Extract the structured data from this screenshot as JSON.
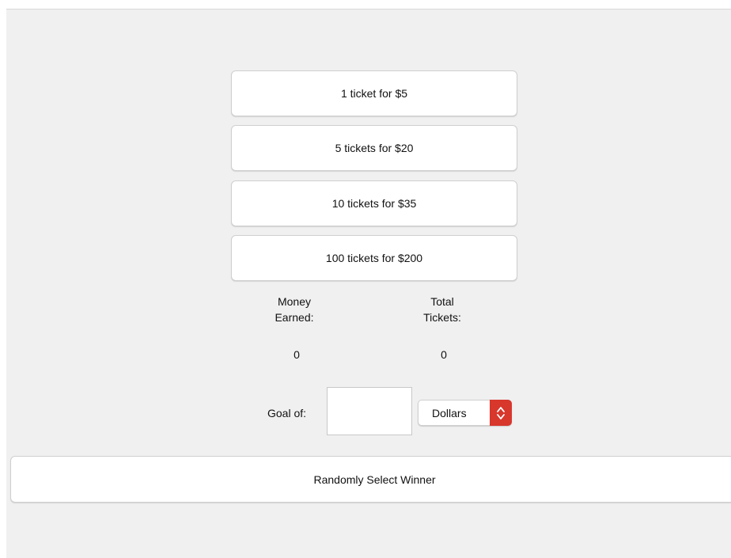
{
  "tickets": [
    {
      "label": "1 ticket for $5"
    },
    {
      "label": "5 tickets for $20"
    },
    {
      "label": "10 tickets for $35"
    },
    {
      "label": "100 tickets for $200"
    }
  ],
  "stats": {
    "money_label": "Money\nEarned:",
    "money_value": "0",
    "tickets_label": "Total\nTickets:",
    "tickets_value": "0"
  },
  "goal": {
    "label": "Goal of:",
    "value": "",
    "unit_selected": "Dollars"
  },
  "winner_button": "Randomly Select Winner",
  "colors": {
    "background": "#f0f0f0",
    "select_accent": "#d8372c"
  }
}
